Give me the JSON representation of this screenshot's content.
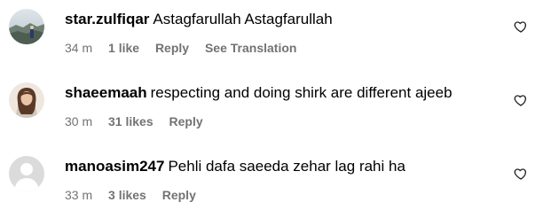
{
  "comments": [
    {
      "username": "star.zulfiqar",
      "text": "Astagfarullah Astagfarullah",
      "time": "34 m",
      "likes": "1 like",
      "reply": "Reply",
      "translate": "See Translation",
      "avatar": "landscape-photo"
    },
    {
      "username": "shaeemaah",
      "text": "respecting and doing shirk are different ajeeb",
      "time": "30 m",
      "likes": "31 likes",
      "reply": "Reply",
      "avatar": "woman-photo"
    },
    {
      "username": "manoasim247",
      "text": "Pehli dafa saeeda zehar lag rahi ha",
      "time": "33 m",
      "likes": "3 likes",
      "reply": "Reply",
      "avatar": "default-user"
    }
  ],
  "icons": {
    "like": "heart-outline-icon"
  },
  "colors": {
    "meta_text": "#737373",
    "primary_text": "#000000",
    "background": "#ffffff"
  }
}
